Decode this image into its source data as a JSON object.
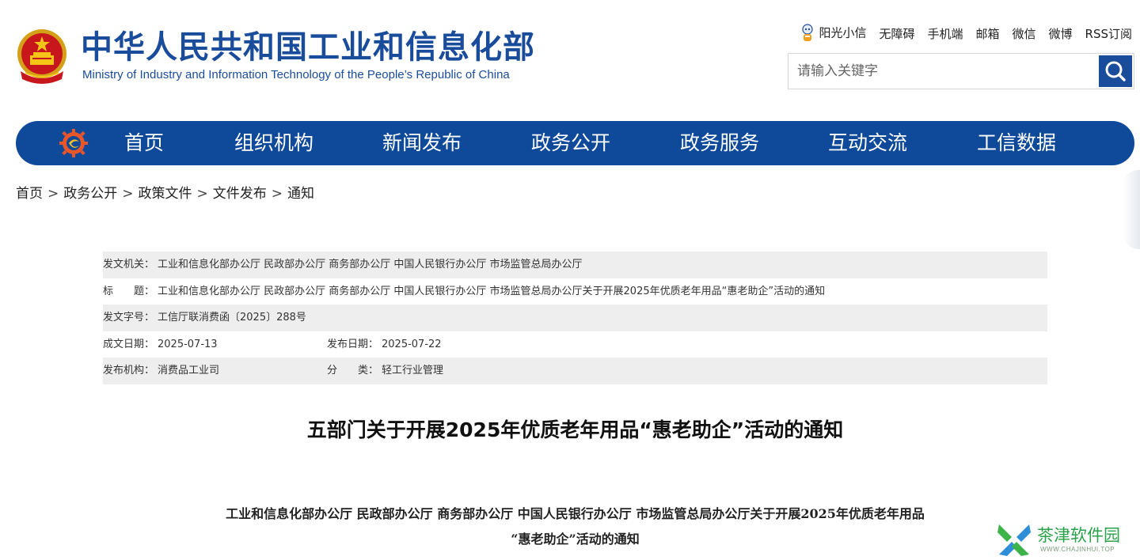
{
  "header": {
    "title": "中华人民共和国工业和信息化部",
    "subtitle": "Ministry of Industry and Information Technology of the People’s Republic of China",
    "top_links": [
      "阳光小信",
      "无障碍",
      "手机端",
      "邮箱",
      "微信",
      "微博",
      "RSS订阅"
    ],
    "search": {
      "placeholder": "请输入关键字"
    }
  },
  "nav": {
    "items": [
      "首页",
      "组织机构",
      "新闻发布",
      "政务公开",
      "政务服务",
      "互动交流",
      "工信数据"
    ]
  },
  "breadcrumb": [
    "首页",
    "政务公开",
    "政策文件",
    "文件发布",
    "通知"
  ],
  "breadcrumb_sep": ">",
  "info": {
    "issuer_label": "发文机关：",
    "issuer": "工业和信息化部办公厅 民政部办公厅 商务部办公厅 中国人民银行办公厅 市场监管总局办公厅",
    "title_label": "标　　题：",
    "title": "工业和信息化部办公厅 民政部办公厅 商务部办公厅 中国人民银行办公厅 市场监管总局办公厅关于开展2025年优质老年用品“惠老助企”活动的通知",
    "doc_no_label": "发文字号：",
    "doc_no": "工信厅联消费函〔2025〕288号",
    "written_label": "成文日期：",
    "written": "2025-07-13",
    "published_label": "发布日期：",
    "published": "2025-07-22",
    "agency_label": "发布机构：",
    "agency": "消费品工业司",
    "category_label": "分　　类：",
    "category": "轻工行业管理"
  },
  "article": {
    "title": "五部门关于开展2025年优质老年用品“惠老助企”活动的通知",
    "heading_line1": "工业和信息化部办公厅 民政部办公厅 商务部办公厅 中国人民银行办公厅 市场监管总局办公厅关于开展2025年优质老年用品",
    "heading_line2": "“惠老助企”活动的通知"
  },
  "watermark": {
    "name": "茶津软件园",
    "url": "WWW.CHAJINHUI.TOP"
  },
  "colors": {
    "brand_blue": "#1a4c9c",
    "nav_blue": "#0f4a9a",
    "row_shade": "#eeeeee",
    "watermark_green": "#2aa24a"
  },
  "icons": [
    "national-emblem-icon",
    "mascot-icon",
    "search-icon",
    "nav-gear-logo-icon",
    "watermark-logo-icon"
  ]
}
